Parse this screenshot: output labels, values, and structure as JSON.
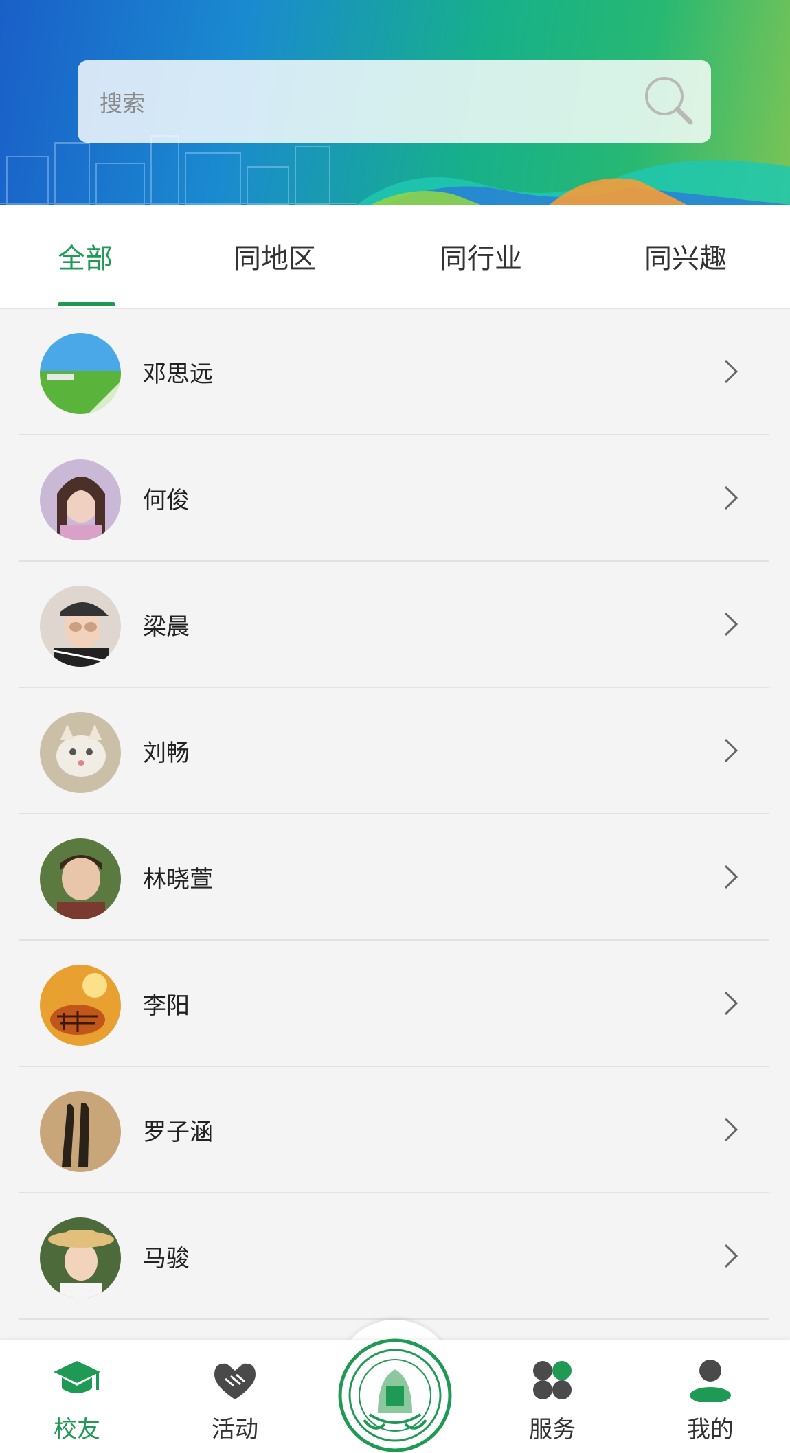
{
  "search": {
    "placeholder": "搜索"
  },
  "tabs": [
    {
      "label": "全部",
      "active": true
    },
    {
      "label": "同地区",
      "active": false
    },
    {
      "label": "同行业",
      "active": false
    },
    {
      "label": "同兴趣",
      "active": false
    }
  ],
  "members": [
    {
      "name": "邓思远",
      "avatar": "field-photo"
    },
    {
      "name": "何俊",
      "avatar": "girl-portrait-photo"
    },
    {
      "name": "梁晨",
      "avatar": "girl-cap-photo"
    },
    {
      "name": "刘畅",
      "avatar": "cat-photo"
    },
    {
      "name": "林晓萱",
      "avatar": "boy-photo"
    },
    {
      "name": "李阳",
      "avatar": "tiger-photo"
    },
    {
      "name": "罗子涵",
      "avatar": "shadow-couple-photo"
    },
    {
      "name": "马骏",
      "avatar": "girl-hat-photo"
    }
  ],
  "bottom_nav": {
    "items": [
      {
        "label": "校友",
        "icon": "graduation-cap-icon",
        "active": true
      },
      {
        "label": "活动",
        "icon": "handshake-icon",
        "active": false
      },
      {
        "label": "服务",
        "icon": "clover-icon",
        "active": false
      },
      {
        "label": "我的",
        "icon": "person-icon",
        "active": false
      }
    ],
    "center_logo": {
      "icon": "alumni-association-logo"
    }
  },
  "colors": {
    "accent": "#1f9a55",
    "icon_gray": "#4a4a4a",
    "background": "#f4f4f4"
  }
}
